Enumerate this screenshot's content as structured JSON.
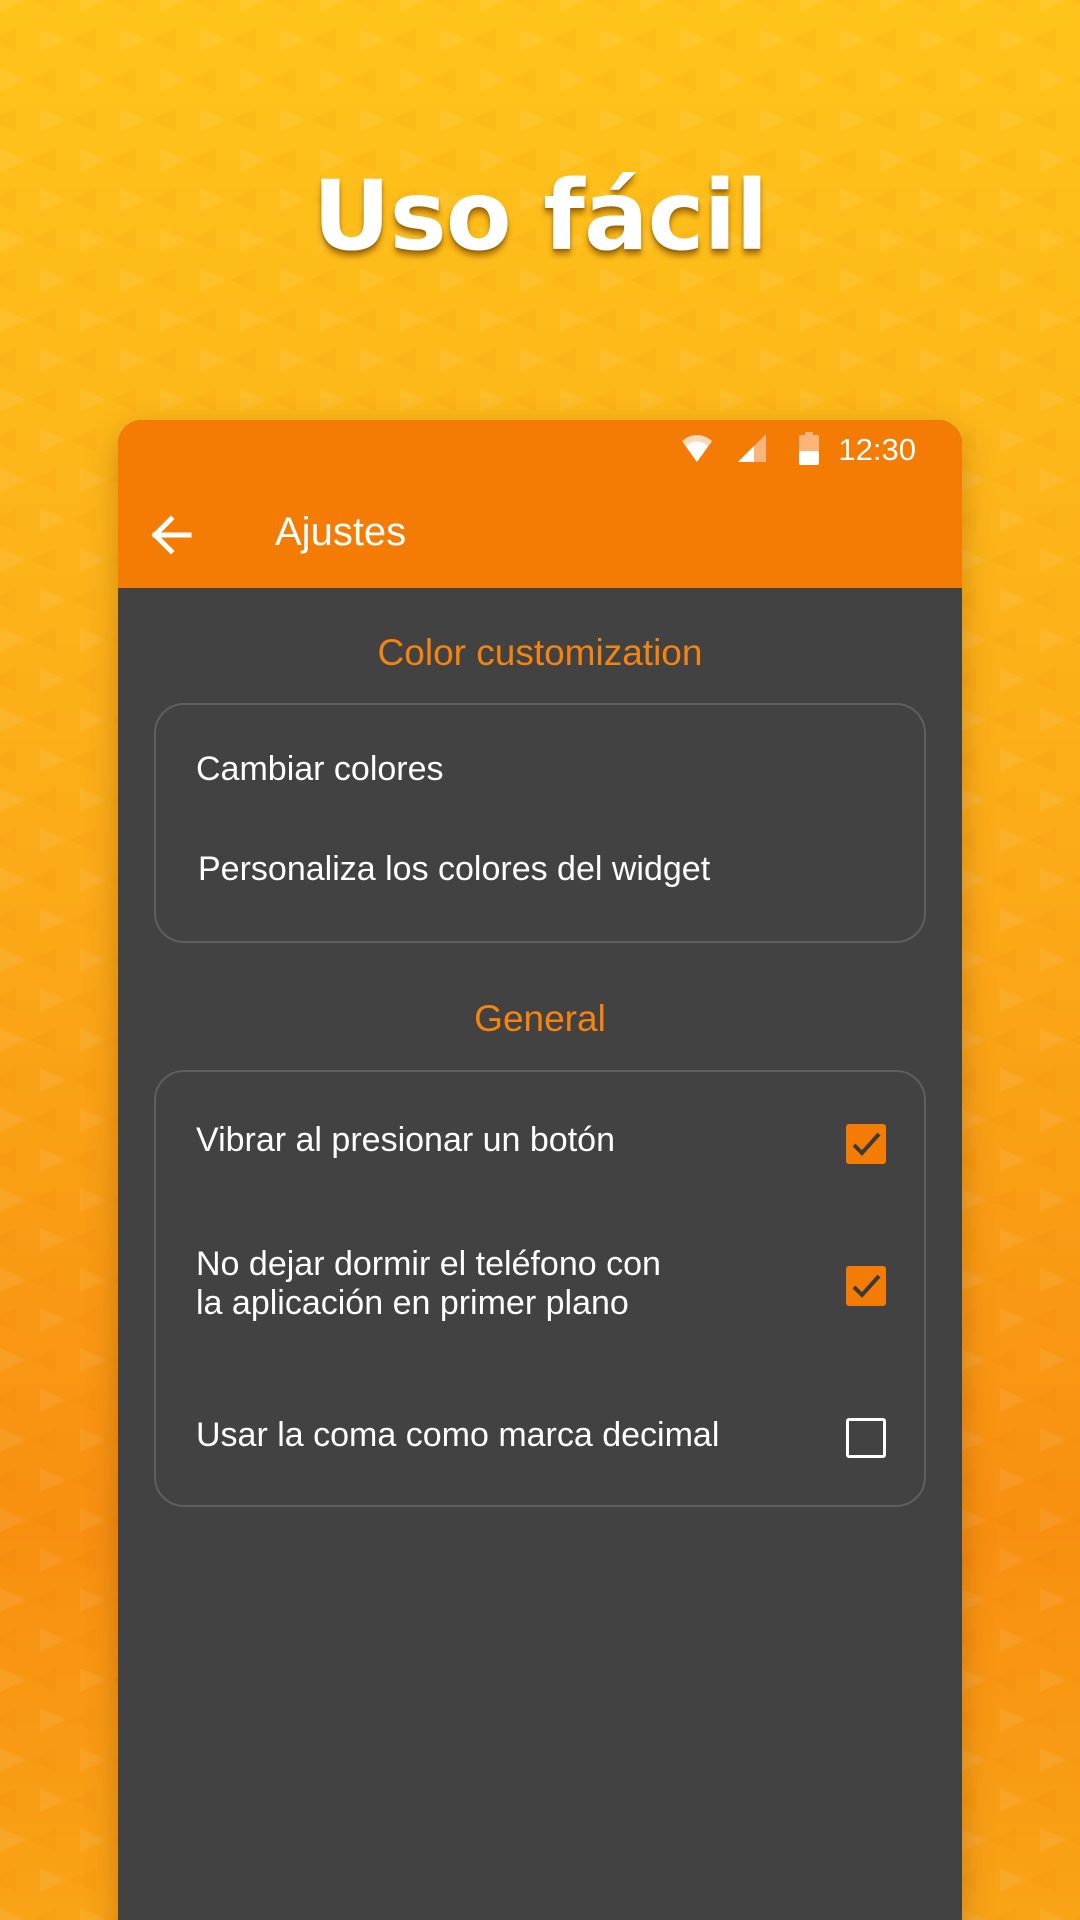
{
  "headline": "Uso fácil",
  "status_bar": {
    "time": "12:30",
    "icons": [
      "wifi-icon",
      "signal-icon",
      "battery-icon"
    ]
  },
  "app_bar": {
    "back_icon": "arrow-left-icon",
    "title": "Ajustes",
    "color": "#f57c04"
  },
  "sections": {
    "color_customization": {
      "title": "Color customization",
      "items": [
        {
          "label": "Cambiar colores"
        },
        {
          "label": "Personaliza los colores del widget"
        }
      ]
    },
    "general": {
      "title": "General",
      "items": [
        {
          "line1": "Vibrar al presionar un botón",
          "checked": true
        },
        {
          "line1": "No dejar dormir el teléfono con",
          "line2": "la aplicación en primer plano",
          "checked": true
        },
        {
          "line1": "Usar la coma como marca decimal",
          "checked": false
        }
      ]
    }
  },
  "colors": {
    "accent": "#f57c04",
    "background": "#424242",
    "section_title": "#f5840e"
  }
}
